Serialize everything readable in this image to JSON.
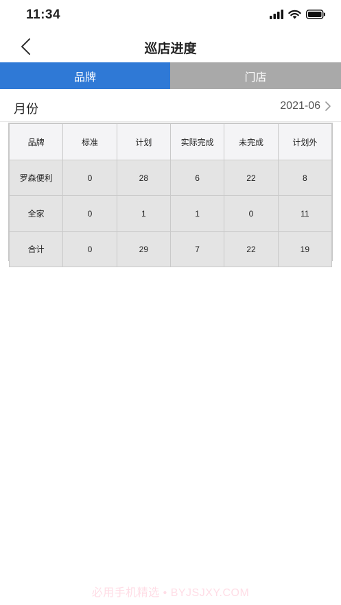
{
  "status_bar": {
    "time": "11:34"
  },
  "nav": {
    "title": "巡店进度"
  },
  "tabs": [
    {
      "label": "品牌",
      "active": true
    },
    {
      "label": "门店",
      "active": false
    }
  ],
  "month": {
    "label": "月份",
    "value": "2021-06"
  },
  "table": {
    "headers": [
      "品牌",
      "标准",
      "计划",
      "实际完成",
      "未完成",
      "计划外"
    ],
    "rows": [
      [
        "罗森便利",
        "0",
        "28",
        "6",
        "22",
        "8"
      ],
      [
        "全家",
        "0",
        "1",
        "1",
        "0",
        "11"
      ],
      [
        "合计",
        "0",
        "29",
        "7",
        "22",
        "19"
      ]
    ]
  },
  "watermark": "必用手机精选 • BYJSJXY.COM",
  "colors": {
    "tab_active": "#2f79d6",
    "tab_inactive": "#a9a9a9"
  }
}
